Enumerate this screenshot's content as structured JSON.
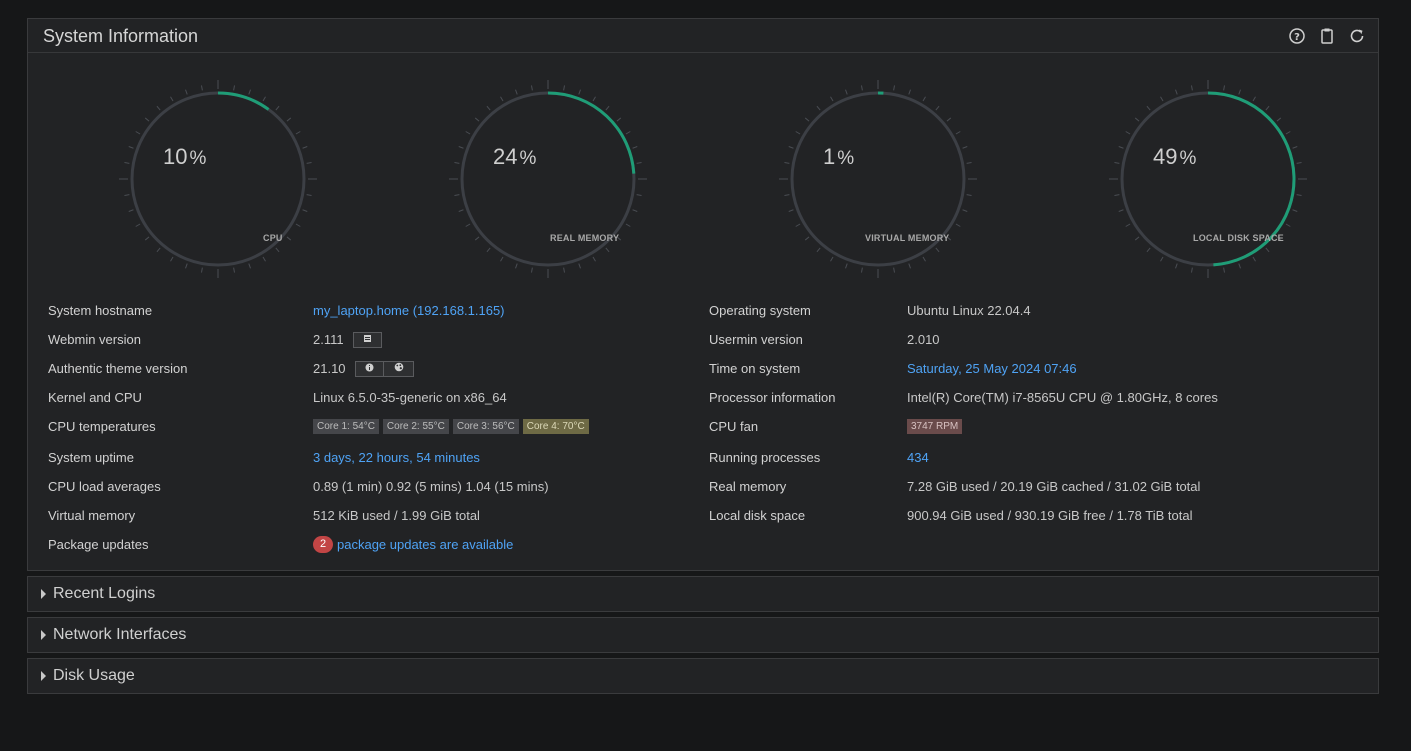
{
  "panel": {
    "title": "System Information",
    "icons": [
      "help-icon",
      "clipboard-icon",
      "refresh-icon"
    ]
  },
  "gauges": [
    {
      "value": "10",
      "unit": "%",
      "label": "CPU",
      "fraction": 0.1
    },
    {
      "value": "24",
      "unit": "%",
      "label": "REAL MEMORY",
      "fraction": 0.24
    },
    {
      "value": "1",
      "unit": "%",
      "label": "VIRTUAL MEMORY",
      "fraction": 0.01
    },
    {
      "value": "49",
      "unit": "%",
      "label": "LOCAL DISK SPACE",
      "fraction": 0.49
    }
  ],
  "left_rows": [
    {
      "label": "System hostname",
      "value": "my_laptop.home (192.168.1.165)"
    },
    {
      "label": "Webmin version",
      "value": "2.111"
    },
    {
      "label": "Authentic theme version",
      "value": "21.10"
    },
    {
      "label": "Kernel and CPU",
      "value": "Linux 6.5.0-35-generic on x86_64"
    },
    {
      "label": "CPU temperatures",
      "tags": [
        "Core 1: 54°C",
        "Core 2: 55°C",
        "Core 3: 56°C",
        "Core 4: 70°C"
      ]
    },
    {
      "label": "System uptime",
      "value": "3 days, 22 hours, 54 minutes"
    },
    {
      "label": "CPU load averages",
      "value": "0.89 (1 min) 0.92 (5 mins) 1.04 (15 mins)"
    },
    {
      "label": "Virtual memory",
      "value": "512 KiB used / 1.99 GiB total"
    },
    {
      "label": "Package updates",
      "badge": "2",
      "value": "package updates are available"
    }
  ],
  "right_rows": [
    {
      "label": "Operating system",
      "value": "Ubuntu Linux 22.04.4"
    },
    {
      "label": "Usermin version",
      "value": "2.010"
    },
    {
      "label": "Time on system",
      "value": "Saturday, 25 May 2024 07:46"
    },
    {
      "label": "Processor information",
      "value": "Intel(R) Core(TM) i7-8565U CPU @ 1.80GHz, 8 cores"
    },
    {
      "label": "CPU fan",
      "tag": "3747 RPM"
    },
    {
      "label": "Running processes",
      "value": "434"
    },
    {
      "label": "Real memory",
      "value": "7.28 GiB used / 20.19 GiB cached / 31.02 GiB total"
    },
    {
      "label": "Local disk space",
      "value": "900.94 GiB used / 930.19 GiB free / 1.78 TiB total"
    }
  ],
  "sections": [
    {
      "title": "Recent Logins"
    },
    {
      "title": "Network Interfaces"
    },
    {
      "title": "Disk Usage"
    }
  ],
  "colors": {
    "accent": "#1f9d77",
    "gauge_track": "#3c3f45",
    "link": "#4fa3f5",
    "badge": "#c24545"
  }
}
